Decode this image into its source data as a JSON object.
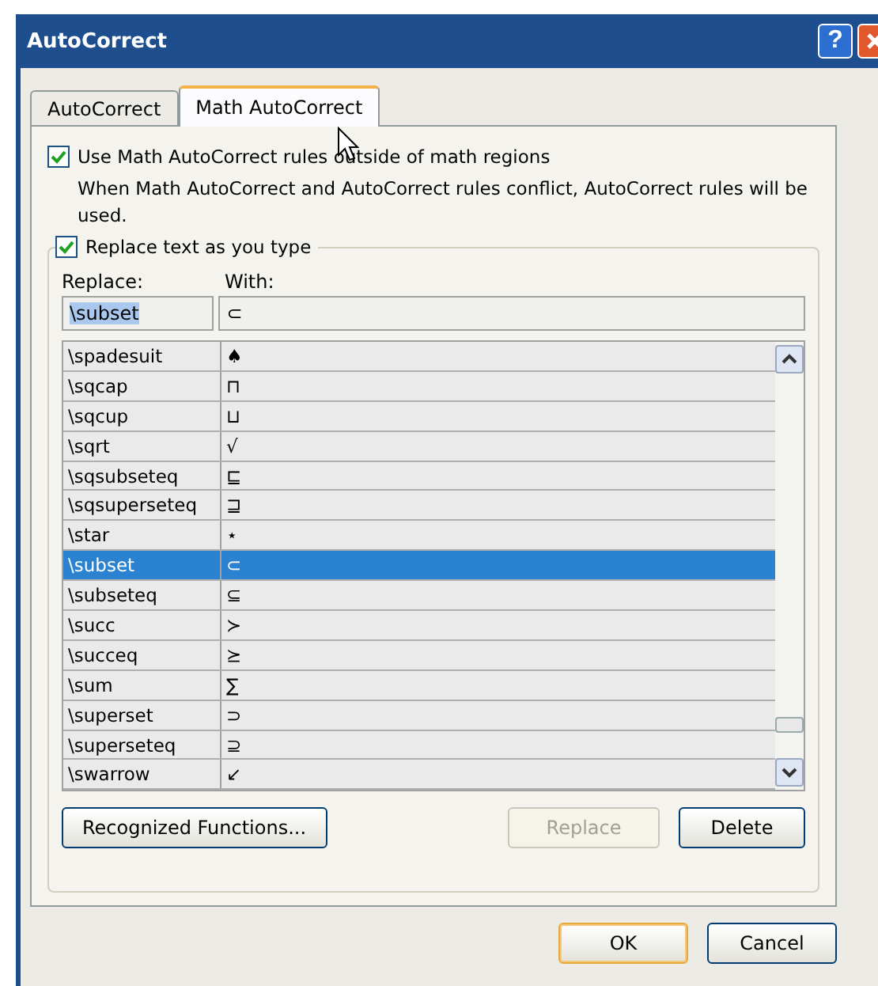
{
  "window": {
    "title": "AutoCorrect"
  },
  "title_buttons": [
    {
      "kind": "help",
      "label": "?"
    },
    {
      "kind": "close"
    }
  ],
  "tabs": [
    {
      "label": "AutoCorrect",
      "selected": false
    },
    {
      "label": "Math AutoCorrect",
      "selected": true
    }
  ],
  "use_outside": {
    "label": "Use Math AutoCorrect rules outside of math regions",
    "checked": true
  },
  "note": "When Math AutoCorrect and AutoCorrect rules conflict, AutoCorrect rules will be used.",
  "replace_group": {
    "label": "Replace text as you type",
    "checked": true
  },
  "columns": [
    "Replace:",
    "With:"
  ],
  "replace_field": {
    "value": "\\subset",
    "value_selected": true
  },
  "with_field": {
    "value": "⊂"
  },
  "rows": [
    {
      "replace": "\\spadesuit",
      "with": "♠",
      "selected": false
    },
    {
      "replace": "\\sqcap",
      "with": "⊓",
      "selected": false
    },
    {
      "replace": "\\sqcup",
      "with": "⊔",
      "selected": false
    },
    {
      "replace": "\\sqrt",
      "with": "√",
      "selected": false
    },
    {
      "replace": "\\sqsubseteq",
      "with": "⊑",
      "selected": false
    },
    {
      "replace": "\\sqsuperseteq",
      "with": "⊒",
      "selected": false
    },
    {
      "replace": "\\star",
      "with": "⋆",
      "selected": false
    },
    {
      "replace": "\\subset",
      "with": "⊂",
      "selected": true
    },
    {
      "replace": "\\subseteq",
      "with": "⊆",
      "selected": false
    },
    {
      "replace": "\\succ",
      "with": "≻",
      "selected": false
    },
    {
      "replace": "\\succeq",
      "with": "⪰",
      "selected": false
    },
    {
      "replace": "\\sum",
      "with": "∑",
      "selected": false
    },
    {
      "replace": "\\superset",
      "with": "⊃",
      "selected": false
    },
    {
      "replace": "\\superseteq",
      "with": "⊇",
      "selected": false
    },
    {
      "replace": "\\swarrow",
      "with": "↙",
      "selected": false
    }
  ],
  "panel_buttons": [
    {
      "label": "Recognized Functions...",
      "disabled": false
    },
    {
      "label": "Replace",
      "disabled": true
    },
    {
      "label": "Delete",
      "disabled": false
    }
  ],
  "dialog_buttons": [
    {
      "label": "OK",
      "default": true
    },
    {
      "label": "Cancel",
      "default": false
    }
  ]
}
